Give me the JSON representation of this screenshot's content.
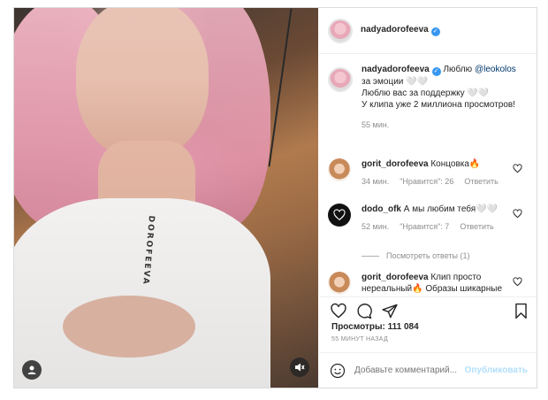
{
  "post": {
    "author": "nadyadorofeeva",
    "media": {
      "collar_text": "DOROFEEVA",
      "user_icon": "user-icon",
      "mute_icon": "sound-off-icon"
    },
    "caption": {
      "author": "nadyadorofeeva",
      "lead": "Люблю",
      "mention": "@leokolos",
      "line1_rest": "за эмоции 🤍🤍",
      "line2": "Люблю вас за поддержку 🤍🤍",
      "line3": "У клипа уже 2 миллиона просмотров!",
      "time": "55 мин."
    },
    "comments": [
      {
        "author": "gorit_dorofeeva",
        "text": "Концовка🔥",
        "time": "34 мин.",
        "likes": "\"Нравится\": 26",
        "reply": "Ответить"
      },
      {
        "author": "dodo_ofk",
        "text": "А мы любим тебя🤍🤍",
        "time": "52 мин.",
        "likes": "\"Нравится\": 7",
        "reply": "Ответить"
      },
      {
        "author": "gorit_dorofeeva",
        "text": "Клип просто нереальный🔥 Образы шикарные"
      }
    ],
    "view_replies": "Посмотреть ответы (1)",
    "views": "Просмотры: 111 084",
    "ago": "55 МИНУТ НАЗАД",
    "add_comment": {
      "placeholder": "Добавьте комментарий...",
      "publish": "Опубликовать"
    },
    "colors": {
      "verified": "#3897f0",
      "link": "#00376b",
      "publish": "#b2dffc",
      "muted": "#8e8e8e"
    }
  }
}
